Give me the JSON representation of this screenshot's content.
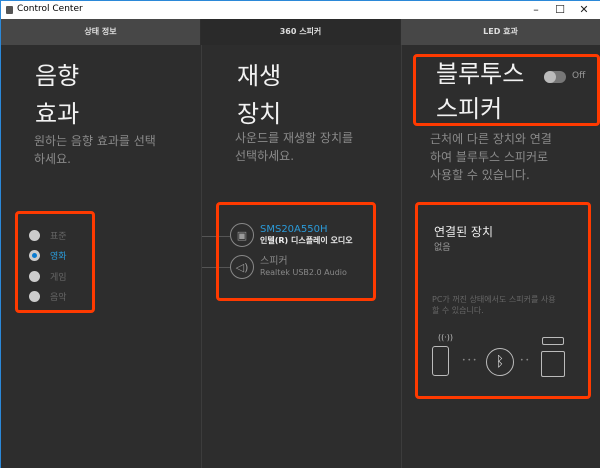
{
  "window": {
    "title": "Control Center",
    "minimize": "–",
    "maximize": "☐",
    "close": "✕"
  },
  "tabs": [
    {
      "label": "상태 정보"
    },
    {
      "label": "360 스피커"
    },
    {
      "label": "LED 효과"
    }
  ],
  "sound_effects": {
    "title_line1": "음향",
    "title_line2": "효과",
    "desc_line1": "원하는 음향 효과를 선택",
    "desc_line2": "하세요.",
    "options": [
      {
        "label": "표준"
      },
      {
        "label": "영화"
      },
      {
        "label": "게임"
      },
      {
        "label": "음악"
      }
    ],
    "selected": "영화"
  },
  "playback": {
    "title_line1": "재생",
    "title_line2": "장치",
    "desc_line1": "사운드를 재생할 장치를",
    "desc_line2": "선택하세요.",
    "devices": [
      {
        "name": "SMS20A550H",
        "sub": "인텔(R) 디스플레이 오디오",
        "icon": "speaker-box-icon"
      },
      {
        "name": "스피커",
        "sub": "Realtek USB2.0 Audio",
        "icon": "volume-icon"
      }
    ]
  },
  "bluetooth": {
    "title_line1": "블루투스",
    "title_line2": "스피커",
    "toggle_label": "Off",
    "toggle_on": false,
    "desc_line1": "근처에 다른 장치와 연결",
    "desc_line2": "하여 블루투스 스피커로",
    "desc_line3": "사용할 수 있습니다.",
    "connected_title": "연결된 장치",
    "connected_value": "없음",
    "note_line1": "PC가 꺼진 상태에서도 스피커를 사용",
    "note_line2": "할 수 있습니다.",
    "dots_left": "• • •",
    "dots_right": "• •"
  },
  "colors": {
    "accent": "#2b9ad8",
    "highlight": "#ff3a00"
  }
}
